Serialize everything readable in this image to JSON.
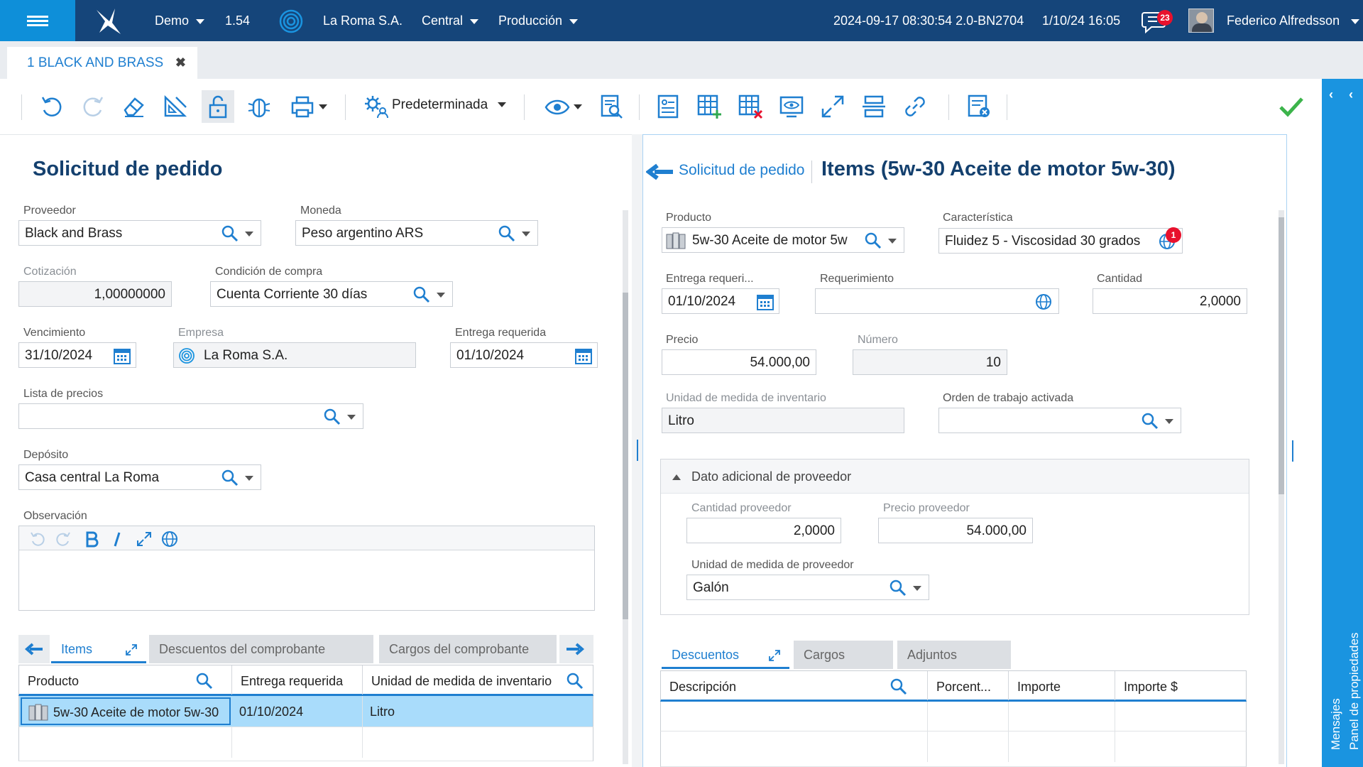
{
  "header": {
    "environment": "Demo",
    "version": "1.54",
    "company": "La Roma S.A.",
    "branch": "Central",
    "mode": "Producción",
    "build": "2024-09-17 08:30:54 2.0-BN2704",
    "datetime": "1/10/24 16:05",
    "messages_count": "23",
    "user": "Federico Alfredsson"
  },
  "tabs": [
    {
      "label": "1 BLACK AND BRASS",
      "close": "✖"
    }
  ],
  "toolbar": {
    "view_label": "Predeterminada"
  },
  "left": {
    "title": "Solicitud de pedido",
    "proveedor": {
      "label": "Proveedor",
      "value": "Black and Brass"
    },
    "moneda": {
      "label": "Moneda",
      "value": "Peso argentino ARS"
    },
    "cotizacion": {
      "label": "Cotización",
      "value": "1,00000000"
    },
    "condicion": {
      "label": "Condición de compra",
      "value": "Cuenta Corriente 30 días"
    },
    "vencimiento": {
      "label": "Vencimiento",
      "value": "31/10/2024"
    },
    "empresa": {
      "label": "Empresa",
      "value": "La Roma S.A."
    },
    "entrega": {
      "label": "Entrega requerida",
      "value": "01/10/2024"
    },
    "lista": {
      "label": "Lista de precios",
      "value": ""
    },
    "deposito": {
      "label": "Depósito",
      "value": "Casa central La Roma"
    },
    "observacion": {
      "label": "Observación",
      "value": ""
    },
    "subtabs": [
      "Items",
      "Descuentos del comprobante",
      "Cargos del comprobante"
    ],
    "grid": {
      "columns": [
        "Producto",
        "Entrega requerida",
        "Unidad de medida de inventario"
      ],
      "rows": [
        [
          "5w-30 Aceite de motor 5w-30",
          "01/10/2024",
          "Litro"
        ]
      ]
    }
  },
  "right": {
    "breadcrumb": "Solicitud de pedido",
    "title": "Items (5w-30 Aceite de motor 5w-30)",
    "producto": {
      "label": "Producto",
      "value": "5w-30 Aceite de motor 5w"
    },
    "caracteristica": {
      "label": "Característica",
      "value": "Fluidez 5 - Viscosidad 30 grados",
      "badge": "1"
    },
    "entrega": {
      "label": "Entrega requeri...",
      "value": "01/10/2024"
    },
    "requerimiento": {
      "label": "Requerimiento",
      "value": ""
    },
    "cantidad": {
      "label": "Cantidad",
      "value": "2,0000"
    },
    "precio": {
      "label": "Precio",
      "value": "54.000,00"
    },
    "numero": {
      "label": "Número",
      "value": "10"
    },
    "unidad": {
      "label": "Unidad de medida de inventario",
      "value": "Litro"
    },
    "orden": {
      "label": "Orden de trabajo activada",
      "value": ""
    },
    "proveedor_section": {
      "title": "Dato adicional de proveedor",
      "cantidad": {
        "label": "Cantidad proveedor",
        "value": "2,0000"
      },
      "precio": {
        "label": "Precio proveedor",
        "value": "54.000,00"
      },
      "unidad": {
        "label": "Unidad de medida de proveedor",
        "value": "Galón"
      }
    },
    "subtabs": [
      "Descuentos",
      "Cargos",
      "Adjuntos"
    ],
    "grid": {
      "columns": [
        "Descripción",
        "Porcent...",
        "Importe",
        "Importe $"
      ]
    }
  },
  "rail": {
    "properties": "Panel de propiedades",
    "messages": "Mensajes"
  },
  "colors": {
    "brand": "#15457a",
    "accent": "#1a94e0",
    "selection": "#a9dcfb"
  }
}
